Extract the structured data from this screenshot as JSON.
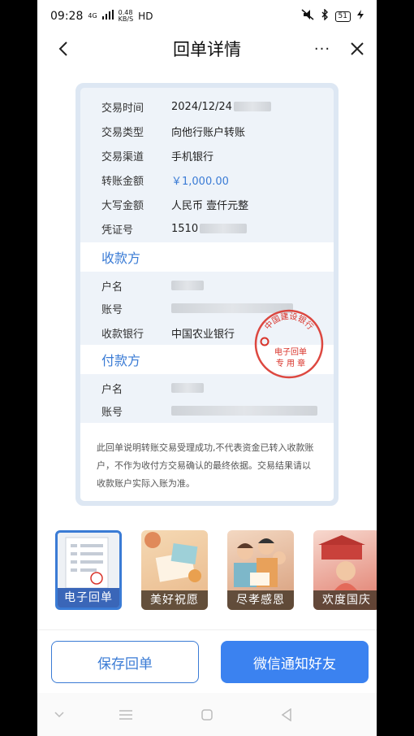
{
  "status_bar": {
    "time": "09:28",
    "signal": "4G",
    "speed": "0.48\nKB/S",
    "hd": "HD",
    "battery": "51"
  },
  "header": {
    "title": "回单详情",
    "back_icon": "chevron-left-icon",
    "more_label": "···",
    "close_icon": "close-icon"
  },
  "receipt": {
    "fields": [
      {
        "label": "交易时间",
        "value": "2024/12/24"
      },
      {
        "label": "交易类型",
        "value": "向他行账户转账"
      },
      {
        "label": "交易渠道",
        "value": "手机银行"
      },
      {
        "label": "转账金额",
        "value": "￥1,000.00"
      },
      {
        "label": "大写金额",
        "value": "人民币 壹仟元整"
      },
      {
        "label": "凭证号",
        "value": "1510"
      }
    ],
    "payee": {
      "heading": "收款方",
      "name_label": "户名",
      "account_label": "账号",
      "bank_label": "收款银行",
      "bank_value": "中国农业银行"
    },
    "payer": {
      "heading": "付款方",
      "name_label": "户名",
      "account_label": "账号"
    },
    "note": "此回单说明转账交易受理成功,不代表资金已转入收款账户，不作为收付方交易确认的最终依据。交易结果请以收款账户实际入账为准。",
    "stamp": {
      "bank": "中国建设银行",
      "line1": "电子回单",
      "line2": "专 用 章",
      "color": "#d9342b"
    }
  },
  "templates": [
    {
      "label": "电子回单",
      "selected": true
    },
    {
      "label": "美好祝愿",
      "selected": false
    },
    {
      "label": "尽孝感恩",
      "selected": false
    },
    {
      "label": "欢度国庆",
      "selected": false
    }
  ],
  "actions": {
    "save": "保存回单",
    "share": "微信通知好友"
  },
  "colors": {
    "accent": "#3b82f0",
    "stamp_red": "#d9342b"
  }
}
